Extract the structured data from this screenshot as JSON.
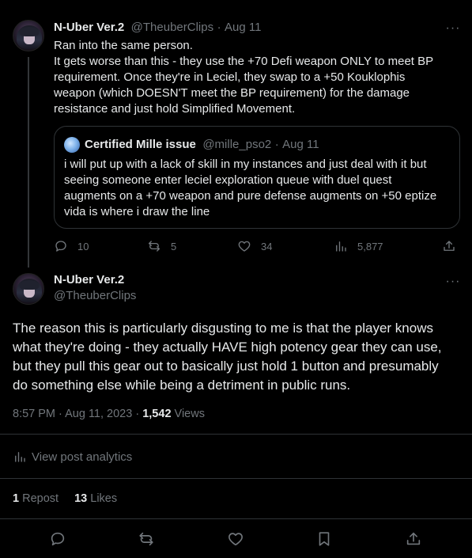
{
  "reply_tweet": {
    "display_name": "N-Uber Ver.2",
    "handle": "@TheuberClips",
    "dot": "·",
    "date": "Aug 11",
    "text_lines": [
      "Ran into the same person.",
      "It gets worse than this - they use the +70 Defi weapon ONLY to meet BP",
      "requirement. Once they're in Leciel, they swap to a +50 Kouklophis",
      "weapon (which DOESN'T meet the BP requirement) for the damage",
      "resistance and just hold Simplified Movement."
    ],
    "more_icon": "···",
    "quote": {
      "display_name": "Certified Mille issue",
      "handle": "@mille_pso2",
      "dot": "·",
      "date": "Aug 11",
      "text_lines": [
        "i will put up with a lack of skill in my instances and just deal with it  but",
        "seeing someone enter leciel exploration queue with duel quest",
        "augments on a +70 weapon and pure defense augments on +50 eptize",
        "vida is where i draw the line"
      ]
    },
    "actions": {
      "replies": "10",
      "reposts": "5",
      "likes": "34",
      "views": "5,877"
    }
  },
  "main_tweet": {
    "display_name": "N-Uber Ver.2",
    "handle": "@TheuberClips",
    "more_icon": "···",
    "text_lines": [
      "The reason this is particularly disgusting to me is that the player knows",
      "what they're doing - they actually HAVE high potency gear they can use,",
      "but they pull this gear out to basically just hold 1 button and presumably",
      "do something else while being a detriment in public runs."
    ],
    "time": "8:57 PM",
    "dot": "·",
    "date": "Aug 11, 2023",
    "views_count": "1,542",
    "views_label": "Views",
    "analytics_label": "View post analytics",
    "repost_count": "1",
    "repost_label": "Repost",
    "likes_count": "13",
    "likes_label": "Likes"
  },
  "icons": {
    "reply": "reply-icon",
    "repost": "repost-icon",
    "like": "heart-icon",
    "views": "views-icon",
    "share": "share-icon",
    "bookmark": "bookmark-icon",
    "analytics": "analytics-icon"
  },
  "colors": {
    "background": "#000000",
    "text": "#e7e9ea",
    "muted": "#71767b",
    "border": "#2f3336"
  }
}
